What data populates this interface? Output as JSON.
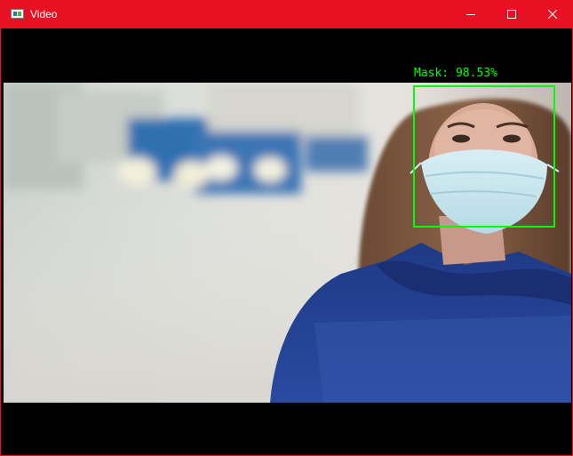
{
  "window": {
    "title": "Video",
    "accent_color": "#e81123",
    "controls": [
      {
        "name": "minimize",
        "icon": "minimize-icon"
      },
      {
        "name": "maximize",
        "icon": "maximize-icon"
      },
      {
        "name": "close",
        "icon": "close-icon"
      }
    ]
  },
  "video": {
    "detection": {
      "label": "Mask: 98.53%",
      "class": "Mask",
      "confidence": 98.53,
      "box_color": "#00ff00"
    }
  }
}
